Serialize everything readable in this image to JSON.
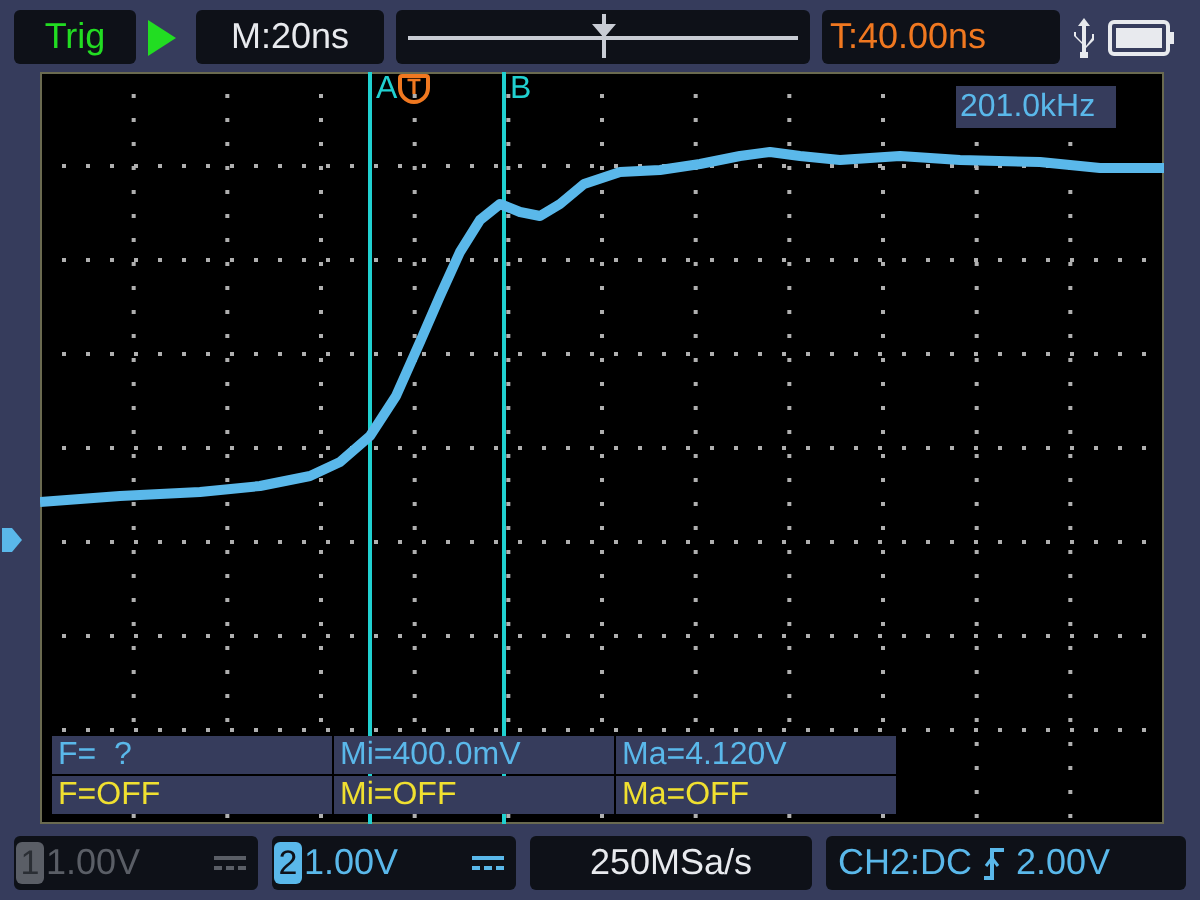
{
  "top_bar": {
    "trigger_status": "Trig",
    "running": true,
    "timebase": "M:20ns",
    "trigger_position": {
      "level": 0.5
    },
    "trigger_time": "T:40.00ns"
  },
  "screen": {
    "cursors": [
      {
        "label": "A"
      },
      {
        "label": "B"
      }
    ],
    "trigger_marker": "T",
    "frequency": "201.0kHz",
    "measurements": [
      {
        "kind": "ch2",
        "cells": [
          "F=  ?",
          "Mi=400.0mV",
          "Ma=4.120V"
        ]
      },
      {
        "kind": "ch1",
        "cells": [
          "F=OFF",
          "Mi=OFF",
          "Ma=OFF"
        ]
      }
    ]
  },
  "bottom_bar": {
    "channels": [
      {
        "number": "1",
        "scale": "1.00V",
        "enabled": false
      },
      {
        "number": "2",
        "scale": "1.00V",
        "enabled": true
      }
    ],
    "sample_rate": "250MSa/s",
    "trigger_source": "CH2:DC",
    "trigger_level": "2.00V"
  }
}
